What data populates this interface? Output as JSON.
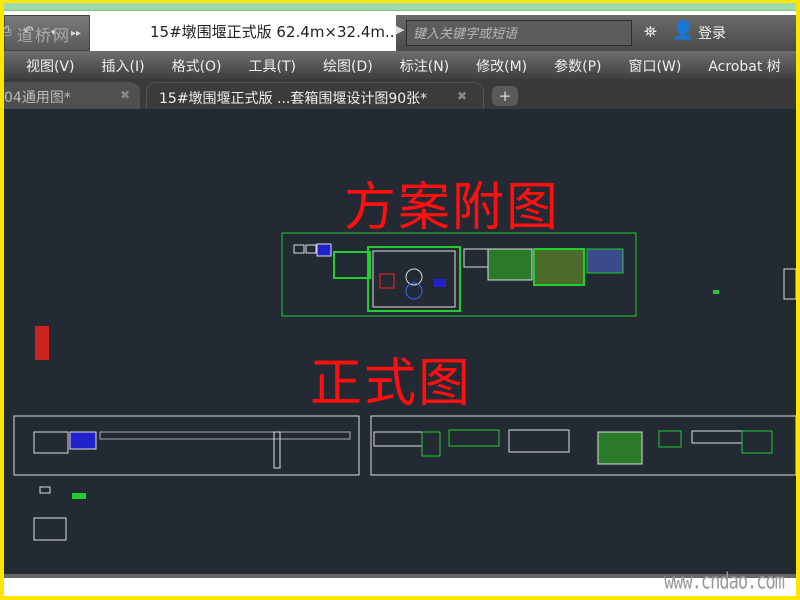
{
  "titlebar": {
    "watermark_logo": "道桥网",
    "doc_title": "15#墩围堰正式版   62.4m×32.4m...",
    "quick_access": [
      "save-icon",
      "undo-icon",
      "dropdown-icon",
      "more-icon"
    ]
  },
  "search": {
    "placeholder": "键入关键字或短语"
  },
  "account": {
    "login": "登录"
  },
  "menu": [
    "视图(V)",
    "插入(I)",
    "格式(O)",
    "工具(T)",
    "绘图(D)",
    "标注(N)",
    "修改(M)",
    "参数(P)",
    "窗口(W)",
    "Acrobat 树"
  ],
  "tabs": [
    {
      "label": "04通用图*"
    },
    {
      "label": "15#墩围堰正式版   ...套箱围堰设计图90张*"
    }
  ],
  "canvas": {
    "label_top": "方案附图",
    "label_mid": "正式图",
    "background": "#232a33",
    "annotation_color": "#ff1010"
  },
  "footer": {
    "watermark": "www.cndao.com"
  }
}
